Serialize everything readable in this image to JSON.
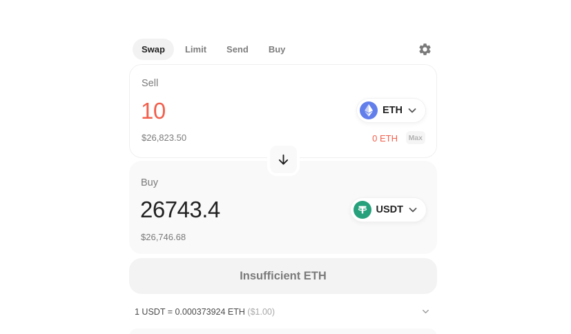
{
  "tabs": [
    {
      "label": "Swap",
      "active": true
    },
    {
      "label": "Limit",
      "active": false
    },
    {
      "label": "Send",
      "active": false
    },
    {
      "label": "Buy",
      "active": false
    }
  ],
  "sell": {
    "label": "Sell",
    "amount": "10",
    "amount_color": "#f25f4c",
    "usd_value": "$26,823.50",
    "token": {
      "symbol": "ETH",
      "icon": "ethereum-icon",
      "color": "#627eea"
    },
    "balance": "0 ETH",
    "balance_color": "#f25f4c",
    "max_label": "Max"
  },
  "buy": {
    "label": "Buy",
    "amount": "26743.4",
    "usd_value": "$26,746.68",
    "token": {
      "symbol": "USDT",
      "icon": "tether-icon",
      "color": "#26a17b"
    }
  },
  "action_button": {
    "label": "Insufficient ETH"
  },
  "rate": {
    "text": "1 USDT = 0.000373924 ETH",
    "usd": "($1.00)"
  },
  "icons": {
    "settings": "gear-icon",
    "switch": "arrow-down-icon",
    "dropdown": "chevron-down-icon"
  }
}
